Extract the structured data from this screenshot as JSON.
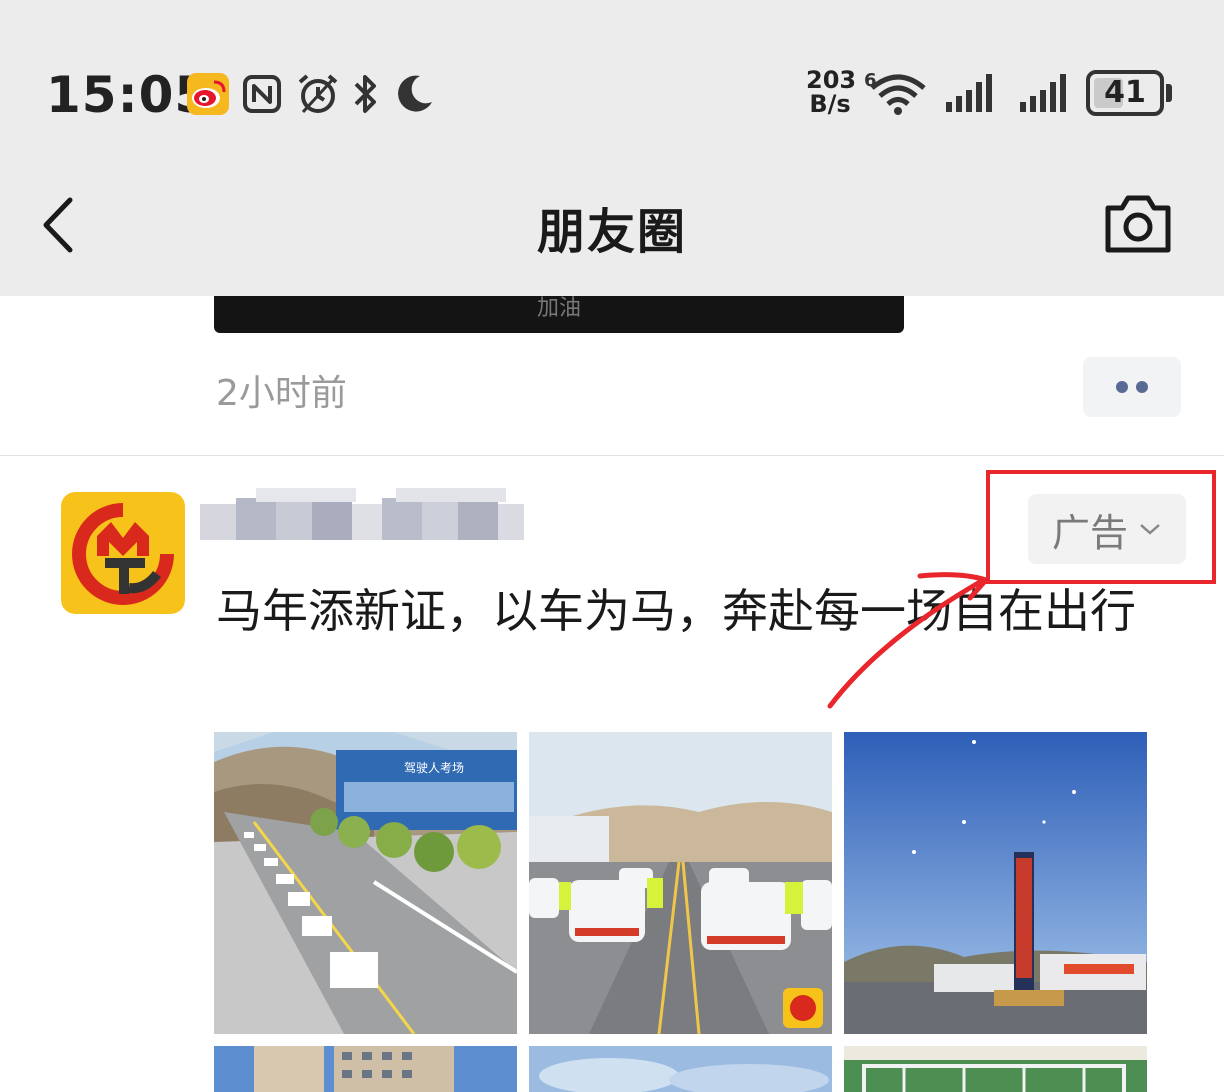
{
  "status_bar": {
    "time": "15:05",
    "net_speed_value": "203",
    "net_speed_unit": "B/s",
    "wifi_badge": "6",
    "battery_level": "41",
    "icons": [
      "weibo-icon",
      "nfc-icon",
      "alarm-icon",
      "bluetooth-icon",
      "moon-icon",
      "wifi-icon",
      "signal-icon",
      "signal-icon",
      "battery-icon"
    ]
  },
  "nav": {
    "title": "朋友圈",
    "back_icon": "chevron-left-icon",
    "camera_icon": "camera-icon"
  },
  "previous_post": {
    "video_caption": "加油",
    "time_ago": "2小时前"
  },
  "ad_post": {
    "badge_label": "广告",
    "text": "马年添新证，以车为马，奔赴每一场自在出行",
    "images": [
      {
        "sign_text": "驾驶人考场"
      },
      {
        "sign_text": ""
      },
      {
        "sign_text": ""
      },
      {
        "sign_text": ""
      },
      {
        "sign_text": ""
      },
      {
        "sign_text": ""
      }
    ]
  },
  "colors": {
    "header_bg": "#ececec",
    "link_blue": "#576b95",
    "annotation_red": "#e8262b",
    "logo_yellow": "#f7c21a",
    "logo_red": "#d9291c"
  }
}
